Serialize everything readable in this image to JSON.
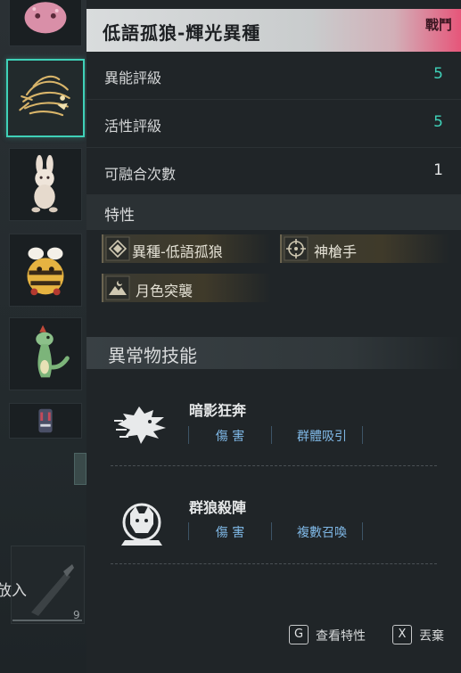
{
  "header": {
    "title": "低語孤狼-輝光異種",
    "badge": "戰鬥"
  },
  "stats": [
    {
      "label": "異能評級",
      "value": "5"
    },
    {
      "label": "活性評級",
      "value": "5"
    },
    {
      "label": "可融合次數",
      "value": "1"
    }
  ],
  "traits": {
    "title": "特性",
    "items": [
      {
        "label": "異種-低語孤狼",
        "icon": "diamond-icon"
      },
      {
        "label": "神槍手",
        "icon": "crosshair-icon"
      },
      {
        "label": "月色突襲",
        "icon": "mountain-moon-icon"
      }
    ]
  },
  "skills": {
    "title": "異常物技能",
    "items": [
      {
        "name": "暗影狂奔",
        "icon": "wolf-dash-icon",
        "tags": [
          "傷 害",
          "群體吸引"
        ]
      },
      {
        "name": "群狼殺陣",
        "icon": "wolf-pack-icon",
        "tags": [
          "傷 害",
          "複數召喚"
        ]
      }
    ]
  },
  "inventory": {
    "slots": [
      "pink-blob-item-icon",
      "golden-wolf-item-icon",
      "plush-bunny-item-icon",
      "bee-mascot-item-icon",
      "green-dinosaur-item-icon",
      "small-robot-item-icon"
    ],
    "put_in_label": "放入",
    "put_in_count": "9"
  },
  "footer": {
    "actions": [
      {
        "key": "G",
        "label": "查看特性"
      },
      {
        "key": "X",
        "label": "丟棄"
      }
    ]
  },
  "colors": {
    "accent": "#3fd1b8",
    "tag": "#7fb8e6",
    "header_gradient_end": "#e6567a"
  }
}
